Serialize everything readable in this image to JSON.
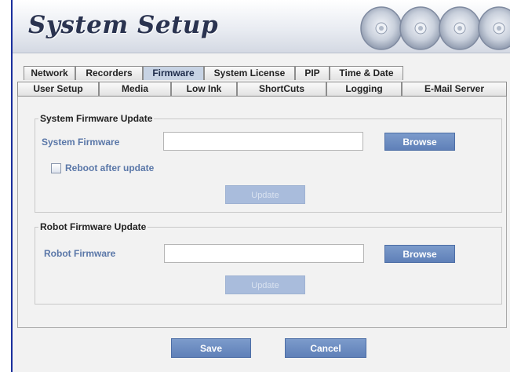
{
  "header": {
    "title": "System Setup"
  },
  "tabs": {
    "row1": [
      {
        "label": "Network"
      },
      {
        "label": "Recorders"
      },
      {
        "label": "Firmware",
        "active": true
      },
      {
        "label": "System License"
      },
      {
        "label": "PIP"
      },
      {
        "label": "Time & Date"
      }
    ],
    "row2": [
      {
        "label": "User Setup"
      },
      {
        "label": "Media"
      },
      {
        "label": "Low Ink"
      },
      {
        "label": "ShortCuts"
      },
      {
        "label": "Logging"
      },
      {
        "label": "E-Mail Server"
      }
    ]
  },
  "system_firmware": {
    "legend": "System Firmware Update",
    "field_label": "System Firmware",
    "value": "",
    "browse_label": "Browse",
    "reboot_label": "Reboot after update",
    "reboot_checked": false,
    "update_label": "Update"
  },
  "robot_firmware": {
    "legend": "Robot Firmware Update",
    "field_label": "Robot Firmware",
    "value": "",
    "browse_label": "Browse",
    "update_label": "Update"
  },
  "footer": {
    "save_label": "Save",
    "cancel_label": "Cancel"
  },
  "colors": {
    "accent": "#5f80b8",
    "label_blue": "#5a77a8",
    "frame_border": "#1a2f9c",
    "disabled_button": "#a9bcdc"
  },
  "icons": {
    "header_graphic": "disc-stack-icon"
  }
}
